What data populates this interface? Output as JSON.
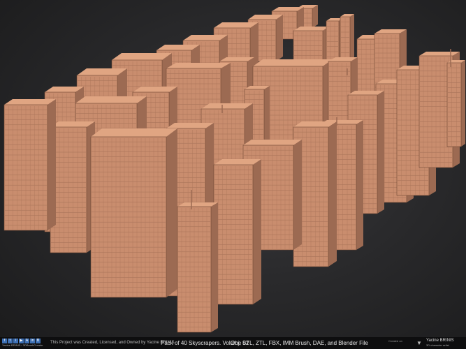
{
  "footer": {
    "social_icons": [
      "facebook-icon",
      "twitter-icon",
      "instagram-icon",
      "youtube-icon",
      "artstation-icon",
      "linkedin-icon",
      "behance-icon"
    ],
    "social_glyphs": [
      "f",
      "t",
      "i",
      "▶",
      "A",
      "in",
      "B"
    ],
    "credit_small": "Yacine BRINIS / 3DBrushCreator",
    "owner_note": "This Project was Created, Licensed, and Owned by Yacine BRINIS",
    "product_title": "Pack of 40 Skyscrapers. Volume 02",
    "formats": "Obj, STL, ZTL, FBX, IMM Brush, DAE, and Blender File",
    "credit_right": "Created on",
    "brand_name": "Yacine BRINIS",
    "brand_sub": "3D character artist"
  },
  "colors": {
    "building_front": "#c98d6e",
    "building_side": "#9c6a52",
    "building_top": "#e0a582",
    "background": "#2a2a2c",
    "footer_bg": "#0e0e0f"
  }
}
